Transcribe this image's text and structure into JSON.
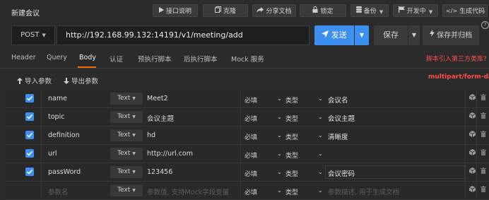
{
  "header": {
    "title": "新建会议",
    "buttons": {
      "api_doc": "接口说明",
      "clone": "克隆",
      "share": "分享文档",
      "lock": "锁定",
      "backup": "备份",
      "status": "开发中",
      "codegen": "生成代码"
    }
  },
  "request": {
    "method": "POST",
    "url": "http://192.168.99.132:14191/v1/meeting/add",
    "send_label": "发送",
    "save_label": "保存",
    "save_doc_label": "保存并归档",
    "help": "?"
  },
  "tabs": [
    "Header",
    "Query",
    "Body",
    "认证",
    "预执行脚本",
    "后执行脚本",
    "Mock 服务"
  ],
  "active_tab": "Body",
  "script_hint": "脚本引入第三方类库?",
  "body_toolbar": {
    "import_label": "导入参数",
    "export_label": "导出参数",
    "content_type": "multipart/form-data"
  },
  "params": [
    {
      "checked": true,
      "name": "name",
      "type": "Text",
      "value": "Meet2",
      "required": "必填",
      "field_type": "类型",
      "desc": "会议名"
    },
    {
      "checked": true,
      "name": "topic",
      "type": "Text",
      "value": "会议主题",
      "required": "必填",
      "field_type": "类型",
      "desc": "会议主题"
    },
    {
      "checked": true,
      "name": "definition",
      "type": "Text",
      "value": "hd",
      "required": "必填",
      "field_type": "类型",
      "desc": "清晰度"
    },
    {
      "checked": true,
      "name": "url",
      "type": "Text",
      "value": "http://url.com",
      "required": "必填",
      "field_type": "类型",
      "desc": ""
    },
    {
      "checked": true,
      "name": "passWord",
      "type": "Text",
      "value": "123456",
      "required": "必填",
      "field_type": "类型",
      "desc": "会议密码"
    }
  ],
  "new_row": {
    "name_placeholder": "参数名",
    "type": "Text",
    "value_placeholder": "参数值, 支持Mock字段变量",
    "required": "必填",
    "field_type": "类型",
    "desc_placeholder": "参数描述, 用于生成文档"
  },
  "colors": {
    "accent": "#3d8ff0",
    "active_tab_underline": "#ff6a00",
    "hint_red": "#ff4d4d"
  }
}
